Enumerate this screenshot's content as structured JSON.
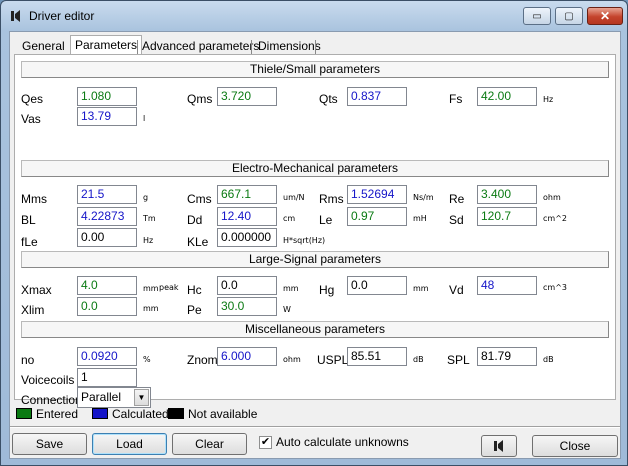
{
  "window": {
    "title": "Driver editor",
    "minimize_glyph": "▭",
    "maximize_glyph": "▢",
    "close_glyph": "✕"
  },
  "tabs": [
    {
      "label": "General",
      "active": false
    },
    {
      "label": "Parameters",
      "active": true
    },
    {
      "label": "Advanced parameters",
      "active": false
    },
    {
      "label": "Dimensions",
      "active": false
    }
  ],
  "sections": {
    "thiele_small": "Thiele/Small parameters",
    "electro_mechanical": "Electro-Mechanical parameters",
    "large_signal": "Large-Signal parameters",
    "misc": "Miscellaneous parameters"
  },
  "params": {
    "qes": {
      "label": "Qes",
      "value": "1.080",
      "unit": ""
    },
    "qms": {
      "label": "Qms",
      "value": "3.720",
      "unit": ""
    },
    "qts": {
      "label": "Qts",
      "value": "0.837",
      "unit": ""
    },
    "fs": {
      "label": "Fs",
      "value": "42.00",
      "unit": "Hz"
    },
    "vas": {
      "label": "Vas",
      "value": "13.79",
      "unit": "l"
    },
    "mms": {
      "label": "Mms",
      "value": "21.5",
      "unit": "g"
    },
    "cms": {
      "label": "Cms",
      "value": "667.1",
      "unit": "um/N"
    },
    "rms": {
      "label": "Rms",
      "value": "1.52694",
      "unit": "Ns/m"
    },
    "re": {
      "label": "Re",
      "value": "3.400",
      "unit": "ohm"
    },
    "bl": {
      "label": "BL",
      "value": "4.22873",
      "unit": "Tm"
    },
    "dd": {
      "label": "Dd",
      "value": "12.40",
      "unit": "cm"
    },
    "le": {
      "label": "Le",
      "value": "0.97",
      "unit": "mH"
    },
    "sd": {
      "label": "Sd",
      "value": "120.7",
      "unit": "cm^2"
    },
    "fle": {
      "label": "fLe",
      "value": "0.00",
      "unit": "Hz"
    },
    "kle": {
      "label": "KLe",
      "value": "0.000000",
      "unit": "H*sqrt(Hz)"
    },
    "xmax": {
      "label": "Xmax",
      "value": "4.0",
      "unit": "mm",
      "extra": "peak"
    },
    "hc": {
      "label": "Hc",
      "value": "0.0",
      "unit": "mm"
    },
    "hg": {
      "label": "Hg",
      "value": "0.0",
      "unit": "mm"
    },
    "vd": {
      "label": "Vd",
      "value": "48",
      "unit": "cm^3"
    },
    "xlim": {
      "label": "Xlim",
      "value": "0.0",
      "unit": "mm"
    },
    "pe": {
      "label": "Pe",
      "value": "30.0",
      "unit": "W"
    },
    "no": {
      "label": "no",
      "value": "0.0920",
      "unit": "%"
    },
    "znom": {
      "label": "Znom",
      "value": "6.000",
      "unit": "ohm"
    },
    "uspl": {
      "label": "USPL",
      "value": "85.51",
      "unit": "dB"
    },
    "spl": {
      "label": "SPL",
      "value": "81.79",
      "unit": "dB"
    },
    "voicecoils": {
      "label": "Voicecoils",
      "value": "1"
    },
    "connection": {
      "label": "Connection",
      "value": "Parallel"
    }
  },
  "legend": {
    "entered": "Entered",
    "calculated": "Calculated",
    "not_available": "Not available",
    "colors": {
      "entered": "#0a7a12",
      "calculated": "#1515c8",
      "not_available": "#000000"
    }
  },
  "buttons": {
    "save": "Save",
    "load": "Load",
    "clear": "Clear",
    "close": "Close"
  },
  "auto_calc": {
    "label": "Auto calculate unknowns",
    "checked": true,
    "glyph": "✔"
  }
}
